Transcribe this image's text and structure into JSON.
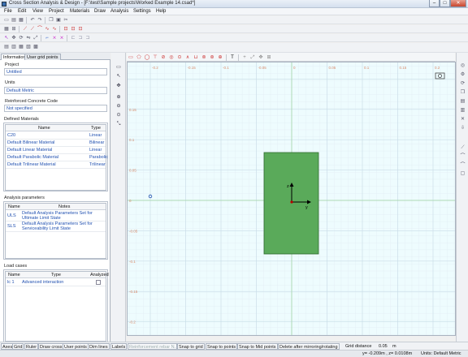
{
  "window": {
    "title": "Cross Section Analysis & Design - [F:\\test\\Sample projects\\Worked Example 14.csad*]"
  },
  "menu": [
    "File",
    "Edit",
    "View",
    "Project",
    "Materials",
    "Draw",
    "Analysis",
    "Settings",
    "Help"
  ],
  "panel": {
    "tabs": [
      "Information",
      "User grid points"
    ],
    "project_label": "Project",
    "project_value": "Untitled",
    "units_label": "Units",
    "units_value": "Default Metric",
    "code_label": "Reinforced Concrete Code",
    "code_value": "Not specified",
    "materials": {
      "title": "Defined Materials",
      "headers": [
        "Name",
        "Type"
      ],
      "rows": [
        {
          "name": "C20",
          "type": "Linear"
        },
        {
          "name": "Default Bilinear Material",
          "type": "Bilinear"
        },
        {
          "name": "Default Linear Material",
          "type": "Linear"
        },
        {
          "name": "Default Parabolic Material",
          "type": "Parabolic"
        },
        {
          "name": "Default Trilinear Material",
          "type": "Trilinear"
        }
      ]
    },
    "analysis": {
      "title": "Analysis parameters",
      "headers": [
        "Name",
        "Notes"
      ],
      "rows": [
        {
          "name": "ULS",
          "notes": "Default Analysis Parameters Set for Ultimate Limit State"
        },
        {
          "name": "SLS",
          "notes": "Default Analysis Parameters Set for Serviceability Limit State"
        }
      ]
    },
    "loads": {
      "title": "Load cases",
      "headers": [
        "Name",
        "Type",
        "Analyzed"
      ],
      "rows": [
        {
          "name": "lc 1",
          "type": "Advanced interaction"
        }
      ]
    }
  },
  "canvas": {
    "top_ticks": [
      "-0.3",
      "-0.25",
      "-0.2",
      "-0.15",
      "-0.1",
      "-0.05",
      "0",
      "0.05",
      "0.1",
      "0.15",
      "0.2",
      "0.25"
    ],
    "left_ticks": [
      "0.15",
      "0.1",
      "0.05",
      "0",
      "-0.05",
      "-0.1",
      "-0.15",
      "-0.2"
    ],
    "axis_y": "y",
    "axis_z": "z"
  },
  "bottom": {
    "buttons": [
      "Axes",
      "Grid",
      "Ruler",
      "Draw cross",
      "User points",
      "Dim lines",
      "Labels",
      "Reinforcement rebar N.",
      "Snap to grid",
      "Snap to points",
      "Snap to Mid points",
      "Delete after mirroring/rotating"
    ],
    "grid_distance_label": "Grid distance",
    "grid_distance_value": "0.05",
    "grid_distance_unit": "m"
  },
  "status": {
    "coords": "y= -0.209m , z= 0.0108m",
    "units": "Units: Default Metric"
  }
}
